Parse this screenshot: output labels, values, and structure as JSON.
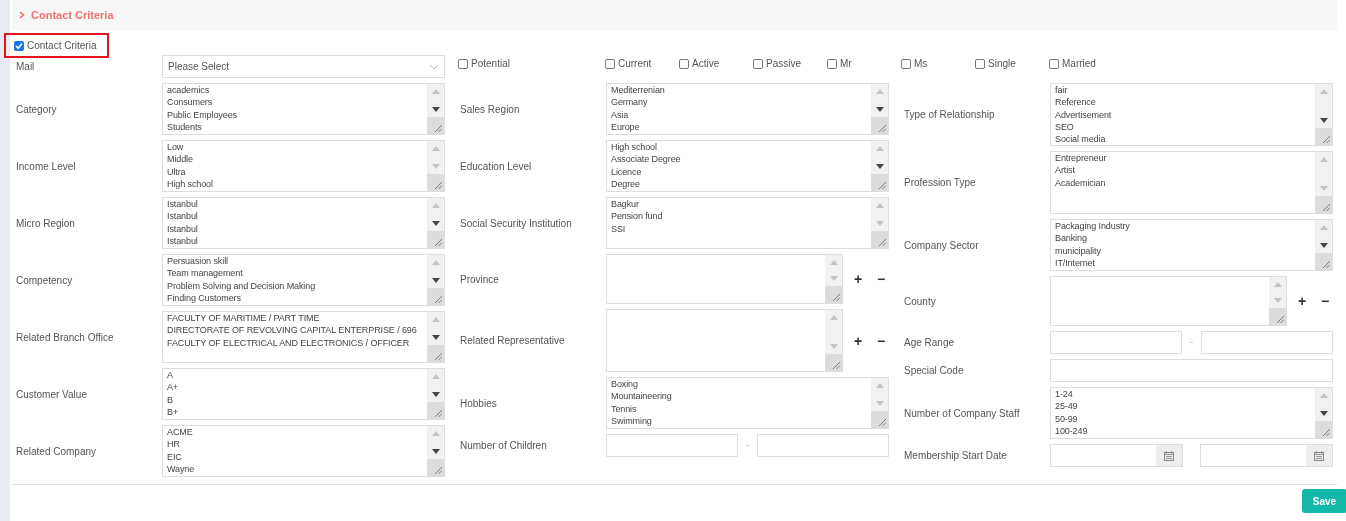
{
  "section": {
    "title": "Contact Criteria"
  },
  "enable_checkbox": {
    "label": "Contact Criteria",
    "checked": true,
    "highlighted": true
  },
  "mail": {
    "label": "Mail",
    "value": "Please Select"
  },
  "flags": [
    {
      "label": "Potential",
      "checked": false
    },
    {
      "label": "Current",
      "checked": false
    },
    {
      "label": "Active",
      "checked": false
    },
    {
      "label": "Passive",
      "checked": false
    },
    {
      "label": "Mr",
      "checked": false
    },
    {
      "label": "Ms",
      "checked": false
    },
    {
      "label": "Single",
      "checked": false
    },
    {
      "label": "Married",
      "checked": false
    }
  ],
  "columns": [
    [
      {
        "label": "Category",
        "kind": "listbox",
        "scrollable": true,
        "options": [
          "academics",
          "Consumers",
          "Public Employees",
          "Students"
        ]
      },
      {
        "label": "Income Level",
        "kind": "listbox",
        "scrollable": false,
        "options": [
          "Low",
          "Middle",
          "Ultra",
          "High school"
        ]
      },
      {
        "label": "Micro Region",
        "kind": "listbox",
        "scrollable": true,
        "options": [
          "Istanbul",
          "Istanbul",
          "Istanbul",
          "Istanbul"
        ]
      },
      {
        "label": "Competency",
        "kind": "listbox",
        "scrollable": true,
        "options": [
          "Persuasion skill",
          "Team management",
          "Problem Solving and Decision Making",
          "Finding Customers"
        ]
      },
      {
        "label": "Related Branch Office",
        "kind": "listbox",
        "scrollable": true,
        "options": [
          "FACULTY OF MARITIME / PART TIME",
          "DIRECTORATE OF REVOLVING CAPITAL ENTERPRISE / 696",
          "FACULTY OF ELECTRICAL AND ELECTRONICS / OFFICER"
        ]
      },
      {
        "label": "Customer Value",
        "kind": "listbox",
        "scrollable": true,
        "options": [
          "A",
          "A+",
          "B",
          "B+"
        ]
      },
      {
        "label": "Related Company",
        "kind": "listbox",
        "scrollable": true,
        "options": [
          "ACME",
          "HR",
          "EIC",
          "Wayne"
        ]
      }
    ],
    [
      {
        "label": "Sales Region",
        "kind": "listbox",
        "scrollable": true,
        "options": [
          "Mediterrenian",
          "Germany",
          "Asia",
          "Europe"
        ]
      },
      {
        "label": "Education Level",
        "kind": "listbox",
        "scrollable": true,
        "options": [
          "High school",
          "Associate Degree",
          "Licence",
          "Degree"
        ]
      },
      {
        "label": "Social Security Institution",
        "kind": "listbox",
        "scrollable": false,
        "options": [
          "Bagkur",
          "Pension fund",
          "SSI"
        ]
      },
      {
        "label": "Province",
        "kind": "listbox_add",
        "scrollable": false,
        "add": "+",
        "remove": "−"
      },
      {
        "label": "Related Representative",
        "kind": "listbox_add_tall",
        "scrollable": false,
        "add": "+",
        "remove": "−"
      },
      {
        "label": "Hobbies",
        "kind": "listbox",
        "scrollable": false,
        "options": [
          "Boxing",
          "Mountaineering",
          "Tennis",
          "Swimming"
        ]
      },
      {
        "label": "Number of Children",
        "kind": "range",
        "separator": "-"
      }
    ],
    [
      {
        "label": "Type of Relationship",
        "kind": "listbox_tall",
        "scrollable": true,
        "options": [
          "fair",
          "Reference",
          "Advertisement",
          "SEO",
          "Social media"
        ]
      },
      {
        "label": "Profession Type",
        "kind": "listbox_tall",
        "scrollable": false,
        "options": [
          "Entrepreneur",
          "Artist",
          "Academician"
        ]
      },
      {
        "label": "Company Sector",
        "kind": "listbox",
        "scrollable": true,
        "options": [
          "Packaging Industry",
          "Banking",
          "municipality",
          "IT/Internet"
        ]
      },
      {
        "label": "County",
        "kind": "listbox_add",
        "scrollable": false,
        "add": "+",
        "remove": "−"
      },
      {
        "label": "Age Range",
        "kind": "range",
        "separator": "-"
      },
      {
        "label": "Special Code",
        "kind": "text"
      },
      {
        "label": "Number of Company Staff",
        "kind": "listbox",
        "scrollable": true,
        "options": [
          "1-24",
          "25-49",
          "50-99",
          "100-249"
        ]
      },
      {
        "label": "Membership Start Date",
        "kind": "date_range"
      }
    ]
  ],
  "save_button": "Save"
}
